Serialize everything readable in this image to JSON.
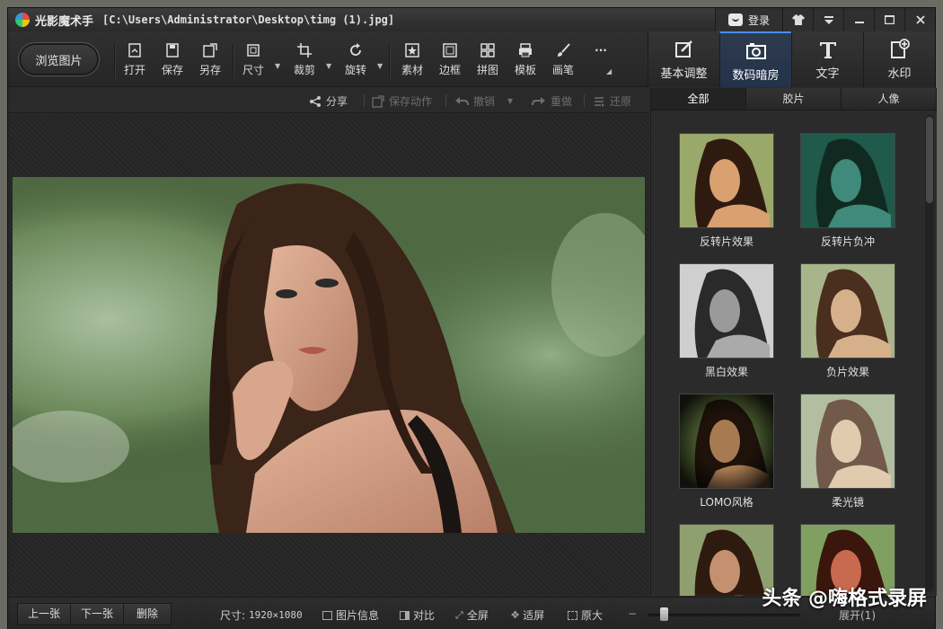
{
  "titlebar": {
    "app_name": "光影魔术手",
    "file_path": "[C:\\Users\\Administrator\\Desktop\\timg (1).jpg]",
    "login_label": "登录"
  },
  "toolbar": {
    "browse_label": "浏览图片",
    "tools": [
      {
        "label": "打开",
        "icon": "open-icon"
      },
      {
        "label": "保存",
        "icon": "save-icon"
      },
      {
        "label": "另存",
        "icon": "save-as-icon"
      },
      {
        "label": "尺寸",
        "icon": "size-icon"
      },
      {
        "label": "裁剪",
        "icon": "crop-icon"
      },
      {
        "label": "旋转",
        "icon": "rotate-icon"
      },
      {
        "label": "素材",
        "icon": "material-icon"
      },
      {
        "label": "边框",
        "icon": "border-icon"
      },
      {
        "label": "拼图",
        "icon": "collage-icon"
      },
      {
        "label": "模板",
        "icon": "template-icon"
      },
      {
        "label": "画笔",
        "icon": "brush-icon"
      }
    ],
    "more_label": "···",
    "mode_tabs": [
      {
        "label": "基本调整",
        "icon": "adjust-icon",
        "active": false
      },
      {
        "label": "数码暗房",
        "icon": "camera-icon",
        "active": true
      },
      {
        "label": "文字",
        "icon": "text-icon",
        "active": false
      },
      {
        "label": "水印",
        "icon": "watermark-icon",
        "active": false
      }
    ]
  },
  "actionbar": {
    "share": "分享",
    "save_action": "保存动作",
    "undo": "撤销",
    "redo": "重做",
    "restore": "还原"
  },
  "panel": {
    "tabs": [
      "全部",
      "胶片",
      "人像"
    ],
    "effects": [
      {
        "label": "反转片效果",
        "tone": "#d9a070"
      },
      {
        "label": "反转片负冲",
        "tone": "#3f8a7a"
      },
      {
        "label": "黑白效果",
        "tone": "#9a9a9a"
      },
      {
        "label": "负片效果",
        "tone": "#d6b08a"
      },
      {
        "label": "LOMO风格",
        "tone": "#5a4a30"
      },
      {
        "label": "柔光镜",
        "tone": "#c9b690"
      },
      {
        "label": "",
        "tone": "#c49070"
      },
      {
        "label": "",
        "tone": "#c86a50"
      }
    ]
  },
  "statusbar": {
    "prev": "上一张",
    "next": "下一张",
    "delete": "删除",
    "size_label": "尺寸:",
    "size_value": "1920×1080",
    "info": "图片信息",
    "compare": "对比",
    "fullscreen": "全屏",
    "fit": "适屏",
    "original": "原大",
    "expand": "展开(1)"
  },
  "watermark": "头条 @嗨格式录屏"
}
